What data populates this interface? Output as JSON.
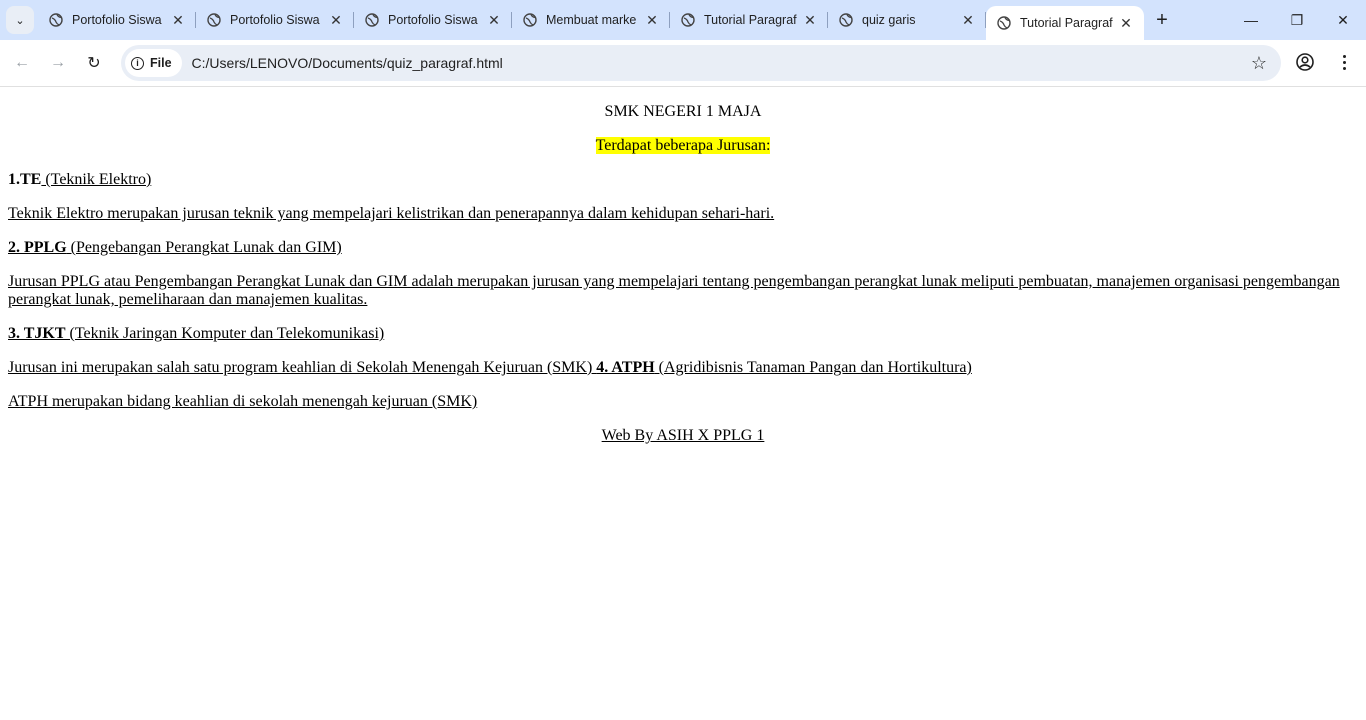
{
  "tabs": [
    {
      "title": "Portofolio Siswa",
      "active": false
    },
    {
      "title": "Portofolio Siswa",
      "active": false
    },
    {
      "title": "Portofolio Siswa",
      "active": false
    },
    {
      "title": "Membuat marke",
      "active": false
    },
    {
      "title": "Tutorial Paragraf",
      "active": false
    },
    {
      "title": "quiz garis",
      "active": false
    },
    {
      "title": "Tutorial Paragraf",
      "active": true
    }
  ],
  "address": {
    "scheme_label": "File",
    "url": "C:/Users/LENOVO/Documents/quiz_paragraf.html"
  },
  "page": {
    "school": "SMK NEGERI 1 MAJA",
    "intro": "Terdapat beberapa Jurusan:",
    "te_code": "1.TE",
    "te_name": " (Teknik Elektro)",
    "te_desc": "Teknik Elektro merupakan jurusan teknik yang mempelajari kelistrikan dan penerapannya dalam kehidupan sehari-hari.",
    "pplg_code": "2. PPLG",
    "pplg_name": " (Pengebangan Perangkat Lunak dan GIM)",
    "pplg_desc": "Jurusan PPLG atau Pengembangan Perangkat Lunak dan GIM adalah merupakan jurusan yang mempelajari tentang pengembangan perangkat lunak meliputi pembuatan, manajemen organisasi pengembangan perangkat lunak, pemeliharaan dan manajemen kualitas.",
    "tjkt_code": "3. TJKT",
    "tjkt_name": " (Teknik Jaringan Komputer dan Telekomunikasi)",
    "tjkt_desc": "Jurusan ini merupakan salah satu program keahlian di Sekolah Menengah Kejuruan (SMK) ",
    "atph_code": "4. ATPH",
    "atph_name": " (Agridibisnis Tanaman Pangan dan Hortikultura)",
    "atph_desc": "ATPH merupakan bidang keahlian di sekolah menengah kejuruan (SMK)",
    "footer": "Web By ASIH X PPLG 1"
  }
}
